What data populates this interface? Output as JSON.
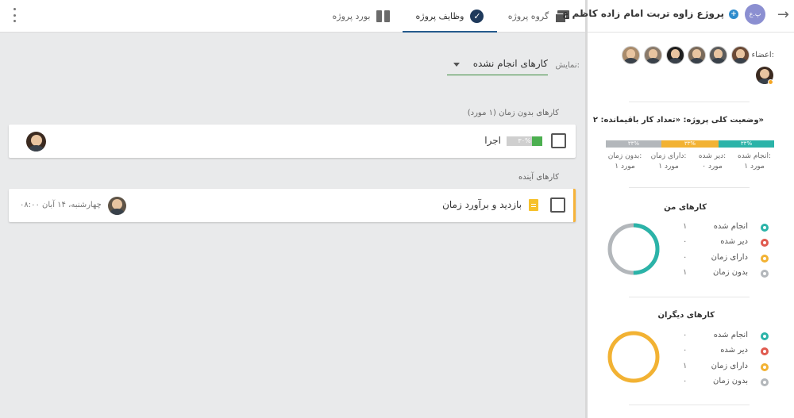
{
  "tabs": {
    "board": "بورد پروژه",
    "tasks": "وظایف پروژه",
    "group": "گروه پروژه"
  },
  "filter": {
    "label": "نمایش:",
    "value": "کارهای انجام نشده"
  },
  "sections": {
    "no_time": "کارهای بدون زمان (۱ مورد)",
    "upcoming": "کارهای آینده"
  },
  "tasks": [
    {
      "title": "اجرا",
      "progress_label": "۳۰%",
      "progress": 0.3
    },
    {
      "title": "بازدید و برآورد زمان",
      "date": "چهارشنبه، ۱۴ آبان ۰۸:۰۰"
    }
  ],
  "sidebar": {
    "project_title": "پروژع زاوه تربت امام زاده کاظم ع",
    "project_avatar": "پ.ع",
    "members_label": "اعضاء:",
    "status_title": "وضعیت کلی پروژه: «تعداد کار باقیمانده: ۲»",
    "status_bar": [
      {
        "label": "۳۳%",
        "value": 0.33,
        "color": "#2bb3a8"
      },
      {
        "label": "۳۳%",
        "value": 0.34,
        "color": "#f2b233"
      },
      {
        "label": "۳۳%",
        "value": 0.33,
        "color": "#b3b7bb"
      }
    ],
    "status_legend": [
      {
        "line1": "انجام شده:",
        "line2": "۱ مورد"
      },
      {
        "line1": "دیر شده:",
        "line2": "۰ مورد"
      },
      {
        "line1": "دارای زمان:",
        "line2": "۱ مورد"
      },
      {
        "line1": "بدون زمان:",
        "line2": "۱ مورد"
      }
    ],
    "my_tasks": {
      "title": "کارهای من",
      "rows": [
        {
          "label": "انجام شده",
          "count": "۱",
          "color": "#2bb3a8"
        },
        {
          "label": "دیر شده",
          "count": "۰",
          "color": "#e05a4f"
        },
        {
          "label": "دارای زمان",
          "count": "۰",
          "color": "#f2b233"
        },
        {
          "label": "بدون زمان",
          "count": "۱",
          "color": "#b3b7bb"
        }
      ]
    },
    "others_tasks": {
      "title": "کارهای دیگران",
      "rows": [
        {
          "label": "انجام شده",
          "count": "۰",
          "color": "#2bb3a8"
        },
        {
          "label": "دیر شده",
          "count": "۰",
          "color": "#e05a4f"
        },
        {
          "label": "دارای زمان",
          "count": "۱",
          "color": "#f2b233"
        },
        {
          "label": "بدون زمان",
          "count": "۰",
          "color": "#b3b7bb"
        }
      ]
    }
  }
}
